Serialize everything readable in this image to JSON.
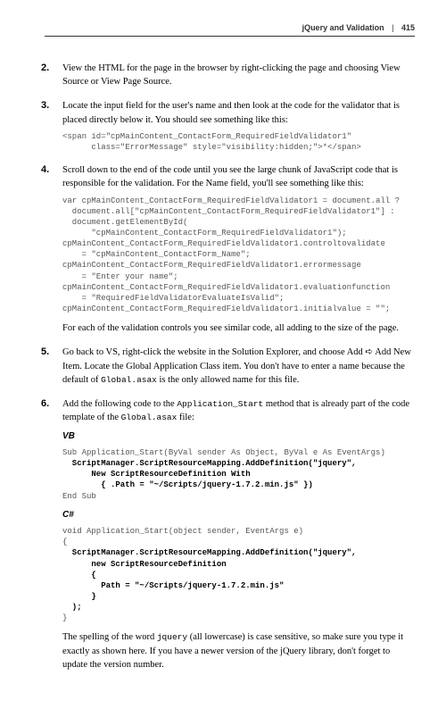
{
  "header": {
    "section": "jQuery and Validation",
    "page": "415"
  },
  "steps": {
    "s2": {
      "text": "View the HTML for the page in the browser by right-clicking the page and choosing View Source or View Page Source."
    },
    "s3": {
      "text": "Locate the input field for the user's name and then look at the code for the validator that is placed directly below it. You should see something like this:",
      "code": "<span id=\"cpMainContent_ContactForm_RequiredFieldValidator1\"\n      class=\"ErrorMessage\" style=\"visibility:hidden;\">*</span>"
    },
    "s4": {
      "text": "Scroll down to the end of the code until you see the large chunk of JavaScript code that is responsible for the validation. For the Name field, you'll see something like this:",
      "code": "var cpMainContent_ContactForm_RequiredFieldValidator1 = document.all ?\n  document.all[\"cpMainContent_ContactForm_RequiredFieldValidator1\"] :\n  document.getElementById(\n      \"cpMainContent_ContactForm_RequiredFieldValidator1\");\ncpMainContent_ContactForm_RequiredFieldValidator1.controltovalidate\n    = \"cpMainContent_ContactForm_Name\";\ncpMainContent_ContactForm_RequiredFieldValidator1.errormessage\n    = \"Enter your name\";\ncpMainContent_ContactForm_RequiredFieldValidator1.evaluationfunction\n    = \"RequiredFieldValidatorEvaluateIsValid\";\ncpMainContent_ContactForm_RequiredFieldValidator1.initialvalue = \"\";",
      "after": "For each of the validation controls you see similar code, all adding to the size of the page."
    },
    "s5": {
      "part1": "Go back to VS, right-click the website in the Solution Explorer, and choose Add ➪ Add New Item. Locate the Global Application Class item. You don't have to enter a name because the default of ",
      "code": "Global.asax",
      "part2": " is the only allowed name for this file."
    },
    "s6": {
      "part1": "Add the following code to the ",
      "code1": "Application_Start",
      "part2": " method that is already part of the code template of the ",
      "code2": "Global.asax",
      "part3": " file:",
      "vb_label": "VB",
      "vb_l1": "Sub Application_Start(ByVal sender As Object, ByVal e As EventArgs)",
      "vb_l2": "  ScriptManager.ScriptResourceMapping.AddDefinition(\"jquery\",",
      "vb_l3": "      New ScriptResourceDefinition With",
      "vb_l4": "        { .Path = \"~/Scripts/jquery-1.7.2.min.js\" })",
      "vb_l5": "End Sub",
      "cs_label": "C#",
      "cs_l1": "void Application_Start(object sender, EventArgs e)",
      "cs_l2": "{",
      "cs_l3": "  ScriptManager.ScriptResourceMapping.AddDefinition(\"jquery\",",
      "cs_l4": "      new ScriptResourceDefinition",
      "cs_l5": "      {",
      "cs_l6": "        Path = \"~/Scripts/jquery-1.7.2.min.js\"",
      "cs_l7": "      }",
      "cs_l8": "  );",
      "cs_l9": "}",
      "after1": "The spelling of the word ",
      "after_code": "jquery",
      "after2": " (all lowercase) is case sensitive, so make sure you type it exactly as shown here. If you have a newer version of the jQuery library, don't forget to update the version number."
    }
  }
}
